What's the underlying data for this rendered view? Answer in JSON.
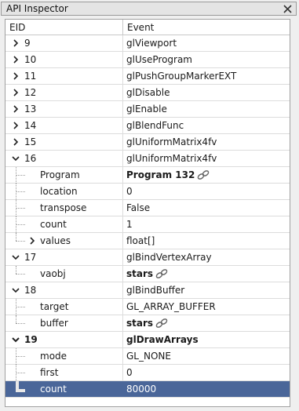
{
  "window": {
    "title": "API Inspector"
  },
  "columns": {
    "eid": "EID",
    "event": "Event"
  },
  "rows": [
    {
      "eid": "9",
      "event": "glViewport"
    },
    {
      "eid": "10",
      "event": "glUseProgram"
    },
    {
      "eid": "11",
      "event": "glPushGroupMarkerEXT"
    },
    {
      "eid": "12",
      "event": "glDisable"
    },
    {
      "eid": "13",
      "event": "glEnable"
    },
    {
      "eid": "14",
      "event": "glBlendFunc"
    },
    {
      "eid": "15",
      "event": "glUniformMatrix4fv"
    },
    {
      "eid": "16",
      "event": "glUniformMatrix4fv"
    },
    {
      "param": "Program",
      "value": "Program 132"
    },
    {
      "param": "location",
      "value": "0"
    },
    {
      "param": "transpose",
      "value": "False"
    },
    {
      "param": "count",
      "value": "1"
    },
    {
      "param": "values",
      "value": "float[]"
    },
    {
      "eid": "17",
      "event": "glBindVertexArray"
    },
    {
      "param": "vaobj",
      "value": "stars"
    },
    {
      "eid": "18",
      "event": "glBindBuffer"
    },
    {
      "param": "target",
      "value": "GL_ARRAY_BUFFER"
    },
    {
      "param": "buffer",
      "value": "stars"
    },
    {
      "eid": "19",
      "event": "glDrawArrays"
    },
    {
      "param": "mode",
      "value": "GL_NONE"
    },
    {
      "param": "first",
      "value": "0"
    },
    {
      "param": "count",
      "value": "80000"
    }
  ],
  "icons": {
    "close": "close-icon",
    "collapsed": "chevron-right-icon",
    "expanded": "chevron-down-icon",
    "resource_link": "link-icon"
  },
  "colors": {
    "selection": "#4a6699"
  }
}
